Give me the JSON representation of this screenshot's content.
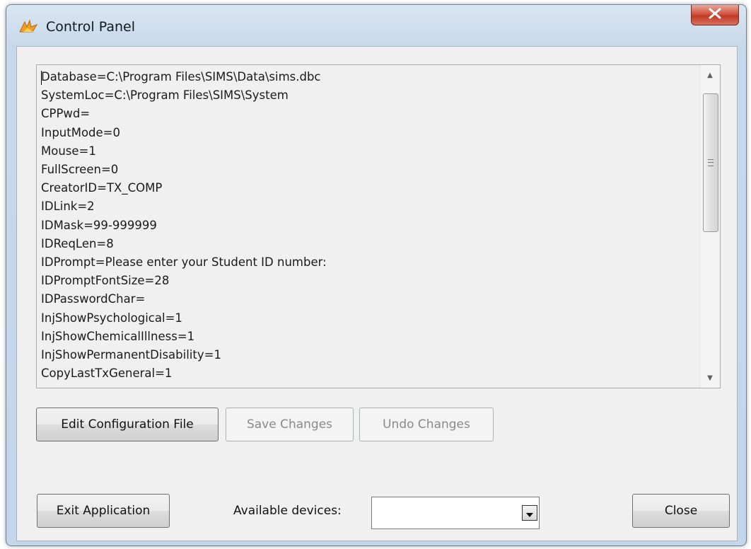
{
  "window": {
    "title": "Control Panel",
    "icon": "app-fox-icon",
    "close_glyph": "X"
  },
  "editor": {
    "lines": [
      "Database=C:\\Program Files\\SIMS\\Data\\sims.dbc",
      "SystemLoc=C:\\Program Files\\SIMS\\System",
      "CPPwd=",
      "InputMode=0",
      "Mouse=1",
      "FullScreen=0",
      "CreatorID=TX_COMP",
      "IDLink=2",
      "IDMask=99-999999",
      "IDReqLen=8",
      "IDPrompt=Please enter your Student ID number:",
      "IDPromptFontSize=28",
      "IDPasswordChar=",
      "InjShowPsychological=1",
      "InjShowChemicalIllness=1",
      "InjShowPermanentDisability=1",
      "CopyLastTxGeneral=1"
    ],
    "scroll_up_glyph": "▲",
    "scroll_down_glyph": "▼"
  },
  "buttons": {
    "edit_config": "Edit Configuration File",
    "save_changes": "Save Changes",
    "undo_changes": "Undo Changes",
    "exit_application": "Exit Application",
    "close": "Close"
  },
  "devices": {
    "label": "Available devices:",
    "selected": ""
  },
  "colors": {
    "frame": "#c7d8ea",
    "client": "#f0f0f0",
    "close_red": "#c03a26"
  }
}
